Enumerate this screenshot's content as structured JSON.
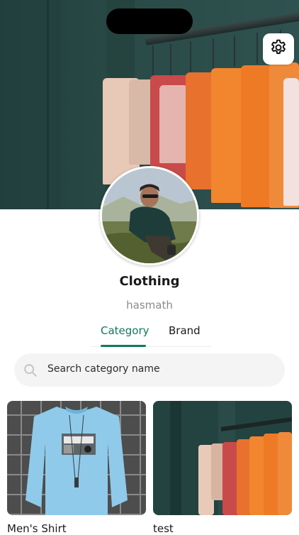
{
  "profile": {
    "name": "Clothing",
    "handle": "hasmath"
  },
  "icons": {
    "settings": "gear-icon",
    "search": "search-icon"
  },
  "tabs": [
    {
      "label": "Category",
      "active": true
    },
    {
      "label": "Brand",
      "active": false
    }
  ],
  "search": {
    "placeholder": "Search category name"
  },
  "cards": [
    {
      "label": "Men's Shirt"
    },
    {
      "label": "test"
    }
  ],
  "colors": {
    "accent": "#0f7a5e"
  }
}
